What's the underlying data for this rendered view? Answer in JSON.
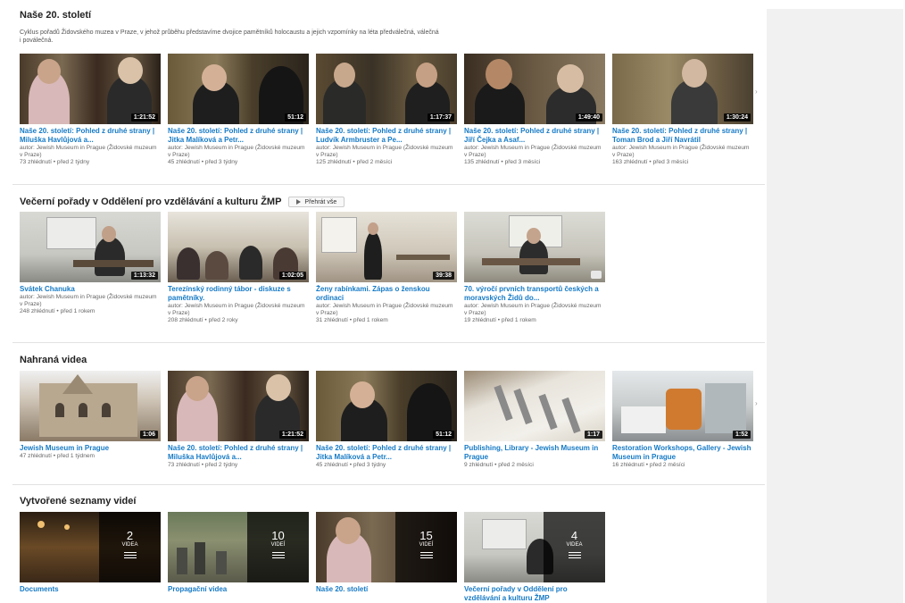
{
  "shelves": [
    {
      "title": "Naše 20. století",
      "description": "Cyklus pořadů Židovského muzea v Praze, v jehož průběhu představíme dvojice pamětníků holocaustu a jejich vzpomínky na léta předválečná, válečná i poválečná.",
      "videos": [
        {
          "title": "Naše 20. století: Pohled z druhé strany | Miluška Havlůjová a...",
          "author": "autor: Jewish Museum in Prague (Židovské muzeum v Praze)",
          "stats": "73 zhlédnutí • před 2 týdny",
          "duration": "1:21:52"
        },
        {
          "title": "Naše 20. století: Pohled z druhé strany | Jitka Malíková a Petr...",
          "author": "autor: Jewish Museum in Prague (Židovské muzeum v Praze)",
          "stats": "45 zhlédnutí • před 3 týdny",
          "duration": "51:12"
        },
        {
          "title": "Naše 20. století: Pohled z druhé strany | Ludvík Armbruster a Pe...",
          "author": "autor: Jewish Museum in Prague (Židovské muzeum v Praze)",
          "stats": "125 zhlédnutí • před 2 měsíci",
          "duration": "1:17:37"
        },
        {
          "title": "Naše 20. století: Pohled z druhé strany | Jiří Čejka a Asaf...",
          "author": "autor: Jewish Museum in Prague (Židovské muzeum v Praze)",
          "stats": "135 zhlédnutí • před 3 měsíci",
          "duration": "1:49:40"
        },
        {
          "title": "Naše 20. století: Pohled z druhé strany | Toman Brod a Jiří Navrátil",
          "author": "autor: Jewish Museum in Prague (Židovské muzeum v Praze)",
          "stats": "163 zhlédnutí • před 3 měsíci",
          "duration": "1:30:24"
        }
      ]
    },
    {
      "title": "Večerní pořady v Oddělení pro vzdělávání a kulturu ŽMP",
      "play_all": "Přehrát vše",
      "videos": [
        {
          "title": "Svátek Chanuka",
          "author": "autor: Jewish Museum in Prague (Židovské muzeum v Praze)",
          "stats": "248 zhlédnutí • před 1 rokem",
          "duration": "1:13:32"
        },
        {
          "title": "Terezínský rodinný tábor - diskuze s pamětníky.",
          "author": "autor: Jewish Museum in Prague (Židovské muzeum v Praze)",
          "stats": "208 zhlédnutí • před 2 roky",
          "duration": "1:02:05"
        },
        {
          "title": "Ženy rabínkami. Zápas o ženskou ordinaci",
          "author": "autor: Jewish Museum in Prague (Židovské muzeum v Praze)",
          "stats": "31 zhlédnutí • před 1 rokem",
          "duration": "39:38"
        },
        {
          "title": "70. výročí prvních transportů českých a moravských Židů do...",
          "author": "autor: Jewish Museum in Prague (Židovské muzeum v Praze)",
          "stats": "19 zhlédnutí • před 1 rokem",
          "duration": ""
        }
      ]
    },
    {
      "title": "Nahraná videa",
      "videos": [
        {
          "title": "Jewish Museum in Prague",
          "stats": "47 zhlédnutí • před 1 týdnem",
          "duration": "1:06"
        },
        {
          "title": "Naše 20. století: Pohled z druhé strany | Miluška Havlůjová a...",
          "stats": "73 zhlédnutí • před 2 týdny",
          "duration": "1:21:52"
        },
        {
          "title": "Naše 20. století: Pohled z druhé strany | Jitka Malíková a Petr...",
          "stats": "45 zhlédnutí • před 3 týdny",
          "duration": "51:12"
        },
        {
          "title": "Publishing, Library - Jewish Museum in Prague",
          "stats": "9 zhlédnutí • před 2 měsíci",
          "duration": "1:17"
        },
        {
          "title": "Restoration Workshops, Gallery - Jewish Museum in Prague",
          "stats": "16 zhlédnutí • před 2 měsíci",
          "duration": "1:52"
        }
      ]
    },
    {
      "title": "Vytvořené seznamy videí",
      "playlists": [
        {
          "title": "Documents",
          "count": "2",
          "word": "VIDEA"
        },
        {
          "title": "Propagační videa",
          "count": "10",
          "word": "VIDEÍ"
        },
        {
          "title": "Naše 20. století",
          "count": "15",
          "word": "VIDEÍ"
        },
        {
          "title": "Večerní pořady v Oddělení pro vzdělávání a kulturu ŽMP",
          "count": "4",
          "word": "VIDEA"
        }
      ]
    }
  ],
  "icons": {
    "next_arrow": "chevron-right-icon",
    "playlist": "playlist-icon",
    "play": "play-icon"
  }
}
